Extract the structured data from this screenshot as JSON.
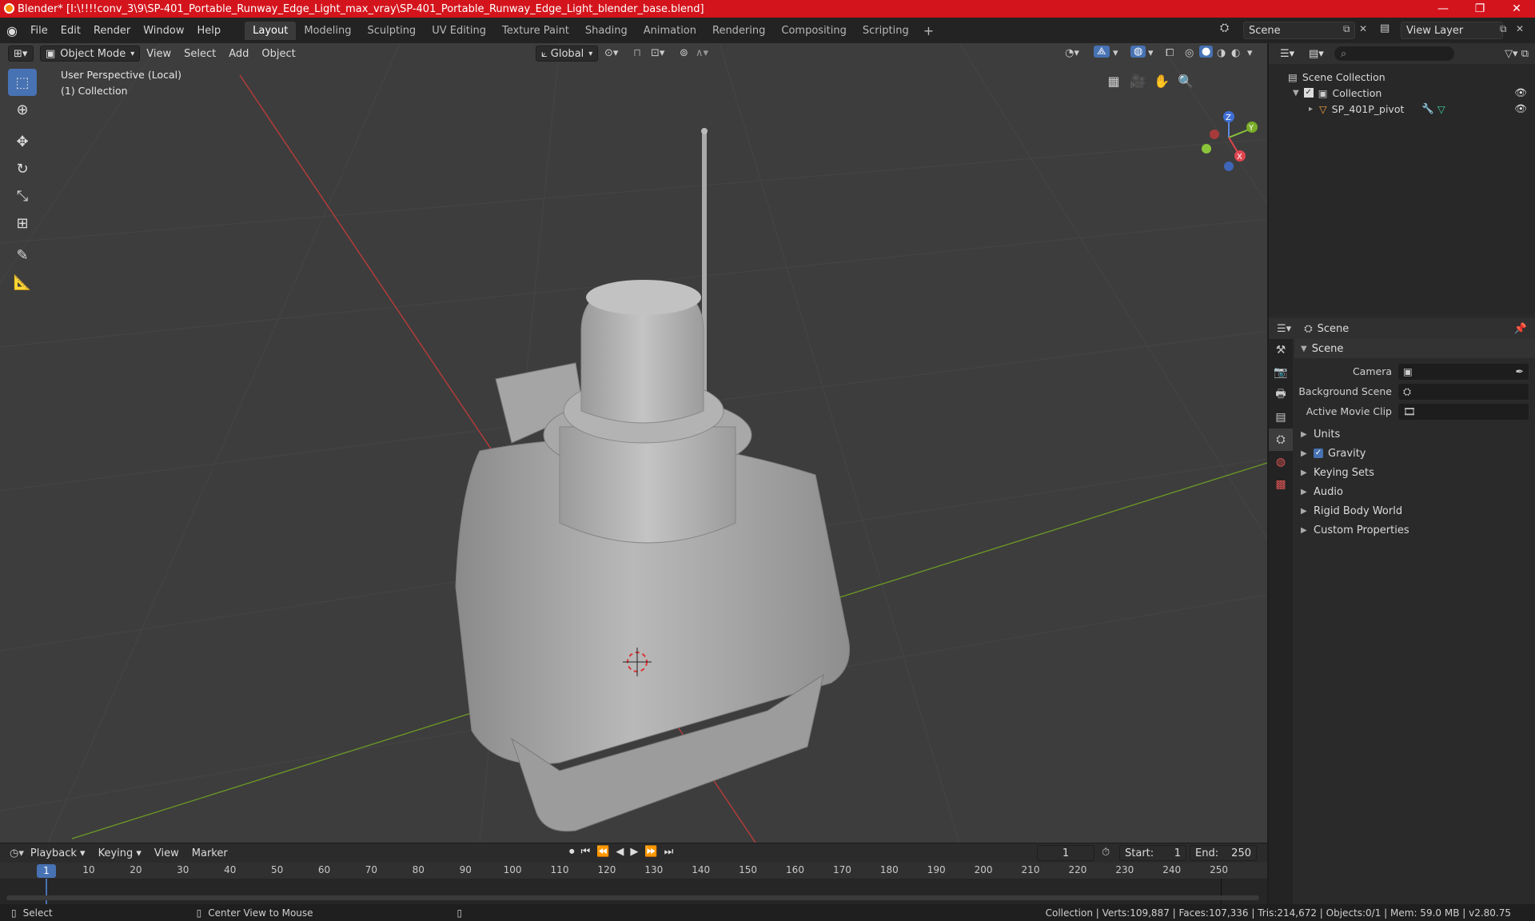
{
  "window": {
    "title": "Blender* [I:\\!!!!conv_3\\9\\SP-401_Portable_Runway_Edge_Light_max_vray\\SP-401_Portable_Runway_Edge_Light_blender_base.blend]",
    "minimize": "—",
    "maximize": "❐",
    "close": "✕"
  },
  "menu": {
    "items": [
      "File",
      "Edit",
      "Render",
      "Window",
      "Help"
    ],
    "workspaces": [
      "Layout",
      "Modeling",
      "Sculpting",
      "UV Editing",
      "Texture Paint",
      "Shading",
      "Animation",
      "Rendering",
      "Compositing",
      "Scripting"
    ],
    "active_workspace": "Layout",
    "add_workspace": "+",
    "scene": "Scene",
    "view_layer": "View Layer"
  },
  "viewport": {
    "mode": "Object Mode",
    "header_menus": [
      "View",
      "Select",
      "Add",
      "Object"
    ],
    "orientation": "Global",
    "info_line1": "User Perspective (Local)",
    "info_line2": "(1) Collection"
  },
  "outliner": {
    "root": "Scene Collection",
    "collection": "Collection",
    "object": "SP_401P_pivot",
    "search_placeholder": ""
  },
  "properties": {
    "header": "Scene",
    "panel": "Scene",
    "fields": [
      {
        "label": "Camera",
        "value": ""
      },
      {
        "label": "Background Scene",
        "value": ""
      },
      {
        "label": "Active Movie Clip",
        "value": ""
      }
    ],
    "subpanels": [
      "Units",
      "Gravity",
      "Keying Sets",
      "Audio",
      "Rigid Body World",
      "Custom Properties"
    ]
  },
  "timeline": {
    "menus": [
      "Playback",
      "Keying",
      "View",
      "Marker"
    ],
    "current_frame": "1",
    "start_label": "Start:",
    "start": "1",
    "end_label": "End:",
    "end": "250",
    "ticks": [
      "1",
      "10",
      "20",
      "30",
      "40",
      "50",
      "60",
      "70",
      "80",
      "90",
      "100",
      "110",
      "120",
      "130",
      "140",
      "150",
      "160",
      "170",
      "180",
      "190",
      "200",
      "210",
      "220",
      "230",
      "240",
      "250"
    ]
  },
  "status": {
    "left": "Select",
    "middle": "Center View to Mouse",
    "right": "Collection | Verts:109,887 | Faces:107,336 | Tris:214,672 | Objects:0/1 | Mem: 59.0 MB | v2.80.75"
  },
  "colors": {
    "accent": "#4772b3",
    "title_bar": "#d4141c",
    "x_axis": "#c23b3b",
    "y_axis": "#6d9a25"
  }
}
